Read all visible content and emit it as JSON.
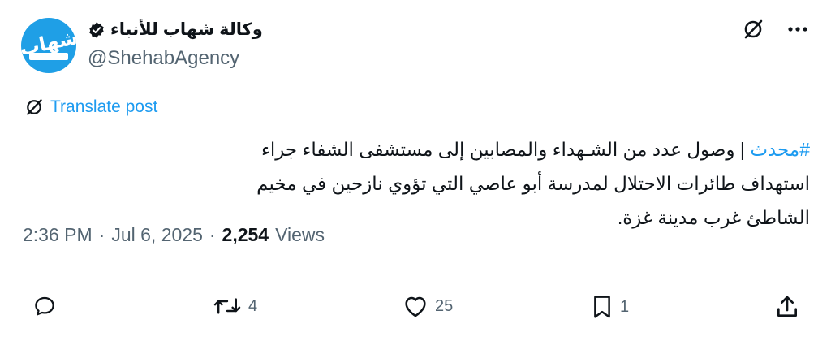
{
  "account": {
    "display_name": "وكالة شهاب للأنباء",
    "handle": "@ShehabAgency",
    "verified": true,
    "avatar_logo_text": "شهاب",
    "avatar_colors": {
      "background": "#1f9fe6",
      "text": "#ffffff"
    }
  },
  "top_actions": {
    "grok_icon": "grok-icon",
    "more_icon": "more-horizontal-icon"
  },
  "translate": {
    "label": "Translate post",
    "icon": "grok-icon"
  },
  "post": {
    "hashtag": "#محدث",
    "text": " | وصول عدد من الشـهداء والمصابين إلى مستشفى الشفاء جراء استهداف طائرات الاحتلال لمدرسة أبو عاصي التي تؤوي نازحين في مخيم الشاطئ غرب مدينة غزة."
  },
  "meta": {
    "time": "2:36 PM",
    "date": "Jul 6, 2025",
    "separator": "·",
    "views_count": "2,254",
    "views_label": "Views"
  },
  "actions": {
    "reply": {
      "icon": "reply-icon",
      "count": ""
    },
    "repost": {
      "icon": "repost-icon",
      "count": "4"
    },
    "like": {
      "icon": "like-icon",
      "count": "25"
    },
    "bookmark": {
      "icon": "bookmark-icon",
      "count": "1"
    },
    "share": {
      "icon": "share-icon",
      "count": ""
    }
  },
  "colors": {
    "link": "#1d9bf0",
    "text": "#0f1419",
    "muted": "#536471"
  }
}
